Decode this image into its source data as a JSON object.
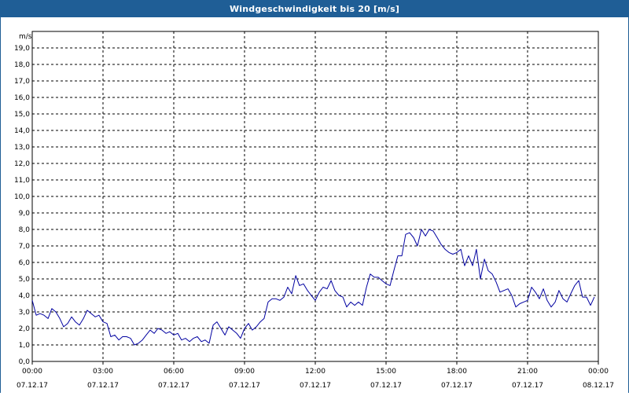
{
  "window": {
    "title": "Windgeschwindigkeit bis 20 [m/s]"
  },
  "colors": {
    "title_bar": "#1f5e96",
    "series": "#0000a0",
    "grid": "#000000"
  },
  "chart_data": {
    "type": "line",
    "title": "Windgeschwindigkeit bis 20 [m/s]",
    "ylabel": "m/s",
    "ylim": [
      0,
      20
    ],
    "y_ticks": [
      "0,0",
      "1,0",
      "2,0",
      "3,0",
      "4,0",
      "5,0",
      "6,0",
      "7,0",
      "8,0",
      "9,0",
      "10,0",
      "11,0",
      "12,0",
      "13,0",
      "14,0",
      "15,0",
      "16,0",
      "17,0",
      "18,0",
      "19,0"
    ],
    "x_range_hours": [
      0,
      24
    ],
    "x_ticks": [
      {
        "time": "00:00",
        "date": "07.12.17"
      },
      {
        "time": "03:00",
        "date": "07.12.17"
      },
      {
        "time": "06:00",
        "date": "07.12.17"
      },
      {
        "time": "09:00",
        "date": "07.12.17"
      },
      {
        "time": "12:00",
        "date": "07.12.17"
      },
      {
        "time": "15:00",
        "date": "07.12.17"
      },
      {
        "time": "18:00",
        "date": "07.12.17"
      },
      {
        "time": "21:00",
        "date": "07.12.17"
      },
      {
        "time": "00:00",
        "date": "08.12.17"
      }
    ],
    "grid": true,
    "grid_style": "dashed",
    "series": [
      {
        "x_hours": [
          0.0,
          0.17,
          0.33,
          0.5,
          0.67,
          0.83,
          1.0,
          1.17,
          1.33,
          1.5,
          1.67,
          1.83,
          2.0,
          2.17,
          2.33,
          2.5,
          2.67,
          2.83,
          3.0,
          3.17,
          3.33,
          3.5,
          3.67,
          3.83,
          4.0,
          4.17,
          4.33,
          4.5,
          4.67,
          4.83,
          5.0,
          5.17,
          5.33,
          5.5,
          5.67,
          5.83,
          6.0,
          6.17,
          6.33,
          6.5,
          6.67,
          6.83,
          7.0,
          7.17,
          7.33,
          7.5,
          7.67,
          7.83,
          8.0,
          8.17,
          8.33,
          8.5,
          8.67,
          8.83,
          9.0,
          9.17,
          9.33,
          9.5,
          9.67,
          9.83,
          10.0,
          10.17,
          10.33,
          10.5,
          10.67,
          10.83,
          11.0,
          11.17,
          11.33,
          11.5,
          11.67,
          11.83,
          12.0,
          12.17,
          12.33,
          12.5,
          12.67,
          12.83,
          13.0,
          13.17,
          13.33,
          13.5,
          13.67,
          13.83,
          14.0,
          14.17,
          14.33,
          14.5,
          14.67,
          14.83,
          15.0,
          15.17,
          15.33,
          15.5,
          15.67,
          15.83,
          16.0,
          16.17,
          16.33,
          16.5,
          16.67,
          16.83,
          17.0,
          17.17,
          17.33,
          17.5,
          17.67,
          17.83,
          18.0,
          18.17,
          18.33,
          18.5,
          18.67,
          18.83,
          19.0,
          19.17,
          19.33,
          19.5,
          19.67,
          19.83,
          20.0,
          20.17,
          20.33,
          20.5,
          20.67,
          20.83,
          21.0,
          21.17,
          21.33,
          21.5,
          21.67,
          21.83,
          22.0,
          22.17,
          22.33,
          22.5,
          22.67,
          22.83,
          23.0,
          23.17,
          23.33,
          23.5,
          23.67,
          23.83
        ],
        "values": [
          3.7,
          2.8,
          2.9,
          2.8,
          2.6,
          3.2,
          3.0,
          2.6,
          2.1,
          2.3,
          2.7,
          2.4,
          2.2,
          2.6,
          3.1,
          2.9,
          2.7,
          2.8,
          2.4,
          2.3,
          1.5,
          1.6,
          1.3,
          1.5,
          1.5,
          1.4,
          1.0,
          1.1,
          1.3,
          1.6,
          1.9,
          1.7,
          2.0,
          1.9,
          1.7,
          1.8,
          1.6,
          1.7,
          1.3,
          1.4,
          1.2,
          1.4,
          1.5,
          1.2,
          1.3,
          1.1,
          2.2,
          2.4,
          2.0,
          1.6,
          2.1,
          1.9,
          1.7,
          1.4,
          2.0,
          2.3,
          1.9,
          2.1,
          2.4,
          2.6,
          3.6,
          3.8,
          3.8,
          3.7,
          3.9,
          4.5,
          4.1,
          5.2,
          4.6,
          4.7,
          4.3,
          4.0,
          3.7,
          4.2,
          4.5,
          4.4,
          4.9,
          4.3,
          4.0,
          3.9,
          3.3,
          3.6,
          3.4,
          3.6,
          3.4,
          4.5,
          5.3,
          5.1,
          5.1,
          4.9,
          4.7,
          4.6,
          5.5,
          6.4,
          6.4,
          7.7,
          7.8,
          7.5,
          7.0,
          8.0,
          7.6,
          8.0,
          7.9,
          7.5,
          7.1,
          6.8,
          6.6,
          6.5,
          6.6,
          6.8,
          5.8,
          6.4,
          5.8,
          6.8,
          5.0,
          6.2,
          5.5,
          5.3,
          4.8,
          4.2,
          4.3,
          4.4,
          4.0,
          3.3,
          3.5,
          3.6,
          3.7,
          4.5,
          4.2,
          3.8,
          4.4,
          3.7,
          3.3,
          3.6,
          4.3,
          3.8,
          3.6,
          4.1,
          4.6,
          4.9,
          3.9,
          3.9,
          3.4,
          3.9
        ]
      }
    ]
  }
}
